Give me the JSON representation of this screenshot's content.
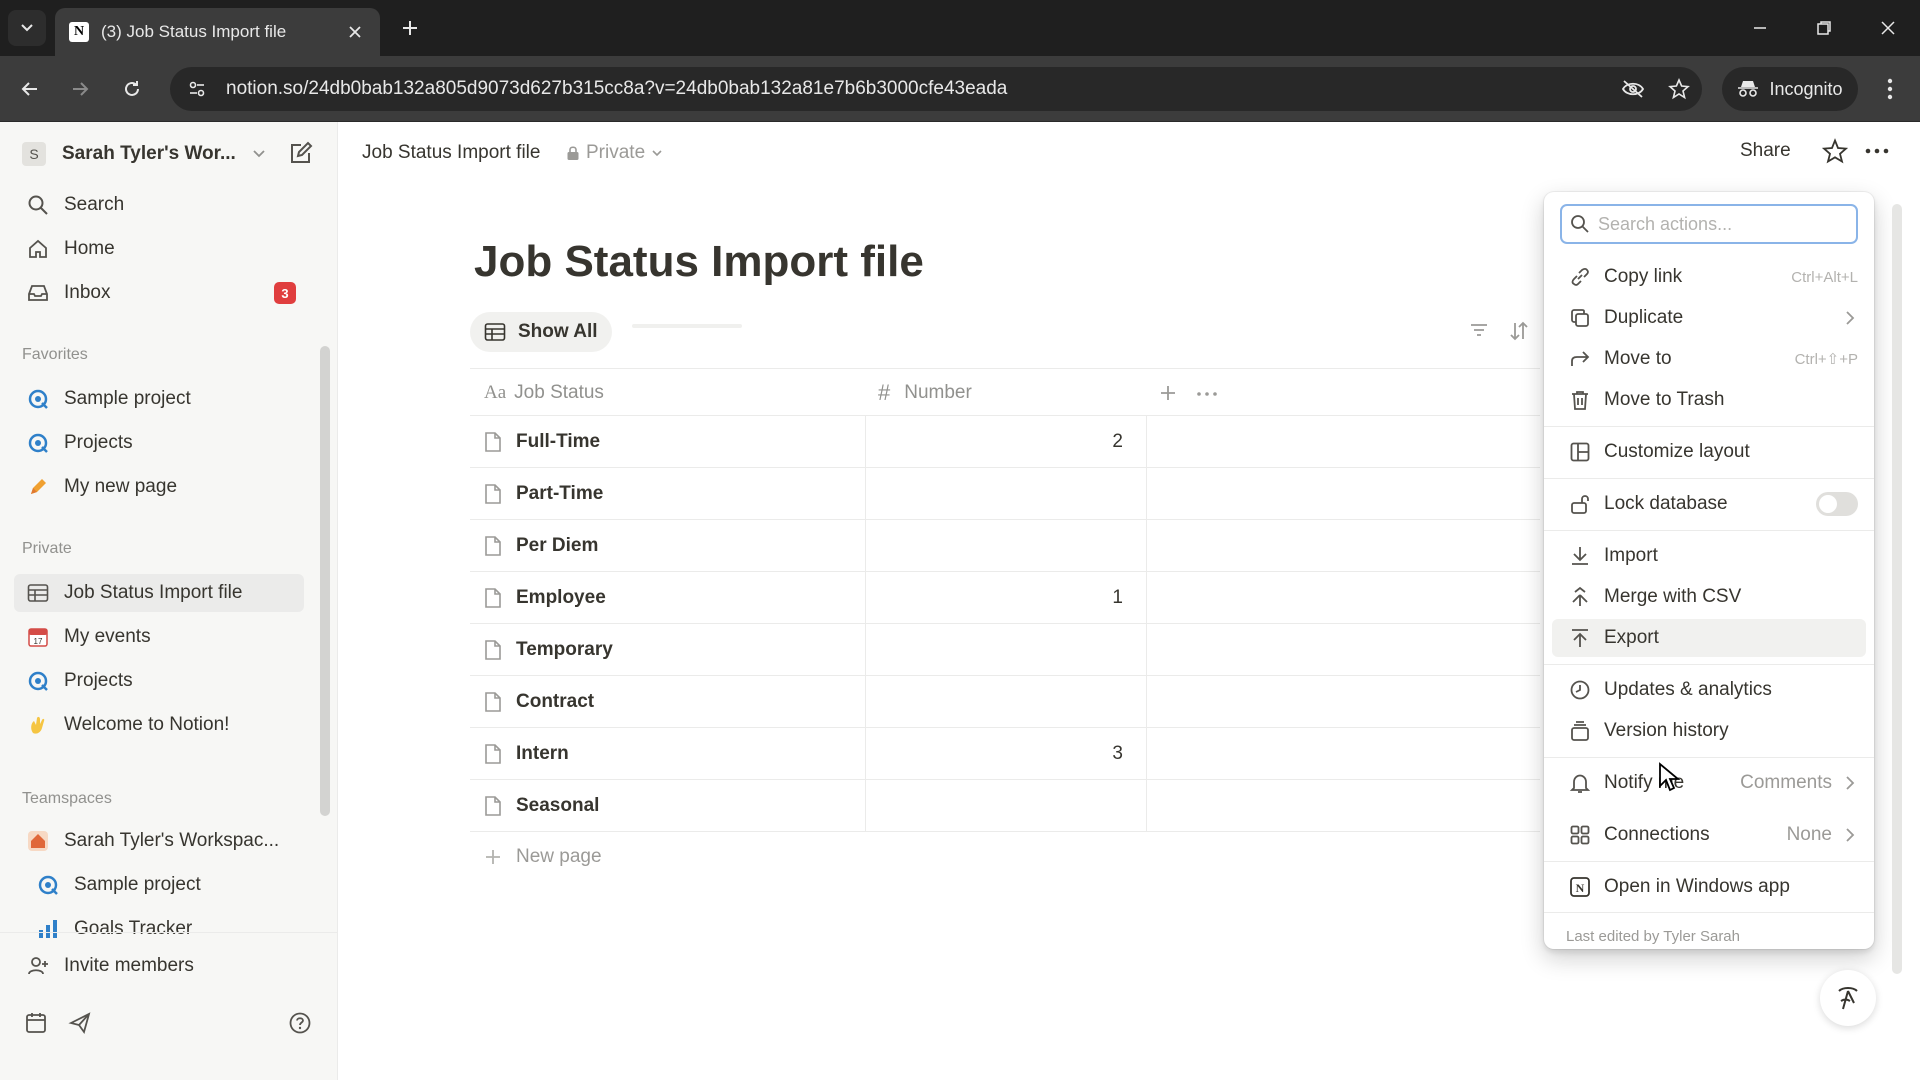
{
  "browser": {
    "tab_title": "(3) Job Status Import file",
    "favicon_letter": "N",
    "url": "notion.so/24db0bab132a805d9073d627b315cc8a?v=24db0bab132a81e7b6b3000cfe43eada",
    "incognito_label": "Incognito"
  },
  "sidebar": {
    "workspace_initial": "S",
    "workspace_name": "Sarah Tyler's Wor...",
    "top_items": [
      {
        "label": "Search",
        "icon": "search-icon"
      },
      {
        "label": "Home",
        "icon": "home-icon"
      },
      {
        "label": "Inbox",
        "icon": "inbox-icon",
        "badge": "3"
      }
    ],
    "favorites_heading": "Favorites",
    "favorites": [
      {
        "label": "Sample project",
        "icon": "project-icon"
      },
      {
        "label": "Projects",
        "icon": "project-icon"
      },
      {
        "label": "My new page",
        "icon": "pencil-icon"
      }
    ],
    "private_heading": "Private",
    "private": [
      {
        "label": "Job Status Import file",
        "icon": "table-icon"
      },
      {
        "label": "My events",
        "icon": "calendar-icon"
      },
      {
        "label": "Projects",
        "icon": "project-icon"
      },
      {
        "label": "Welcome to Notion!",
        "icon": "wave-icon"
      }
    ],
    "teamspaces_heading": "Teamspaces",
    "teamspaces": [
      {
        "label": "Sarah Tyler's Workspac...",
        "icon": "house-icon"
      },
      {
        "label": "Sample project",
        "icon": "project-icon"
      },
      {
        "label": "Goals Tracker",
        "icon": "chart-icon"
      }
    ],
    "invite_label": "Invite members"
  },
  "topbar": {
    "breadcrumb": "Job Status Import file",
    "privacy": "Private",
    "share": "Share"
  },
  "page": {
    "title": "Job Status Import file",
    "view_label": "Show All",
    "columns": [
      {
        "prefix": "Aa",
        "label": "Job Status"
      },
      {
        "prefix": "#",
        "label": "Number"
      }
    ],
    "rows": [
      {
        "name": "Full-Time",
        "number": "2"
      },
      {
        "name": "Part-Time",
        "number": ""
      },
      {
        "name": "Per Diem",
        "number": ""
      },
      {
        "name": "Employee",
        "number": "1"
      },
      {
        "name": "Temporary",
        "number": ""
      },
      {
        "name": "Contract",
        "number": ""
      },
      {
        "name": "Intern",
        "number": "3"
      },
      {
        "name": "Seasonal",
        "number": ""
      }
    ],
    "new_page": "New page"
  },
  "menu": {
    "search_placeholder": "Search actions...",
    "items": {
      "copy_link": "Copy link",
      "copy_link_shortcut": "Ctrl+Alt+L",
      "duplicate": "Duplicate",
      "move_to": "Move to",
      "move_to_shortcut": "Ctrl+⇧+P",
      "move_to_trash": "Move to Trash",
      "customize_layout": "Customize layout",
      "lock_database": "Lock database",
      "import": "Import",
      "merge_csv": "Merge with CSV",
      "export": "Export",
      "updates": "Updates & analytics",
      "version_history": "Version history",
      "notify_me": "Notify me",
      "notify_value": "Comments",
      "connections": "Connections",
      "connections_value": "None",
      "open_app": "Open in Windows app"
    },
    "lock_database_on": false,
    "footer": "Last edited by Tyler Sarah"
  },
  "colors": {
    "accent_red": "#e03e3e",
    "chrome_dark": "#1f1f1f",
    "sidebar_bg": "#f7f7f5"
  }
}
